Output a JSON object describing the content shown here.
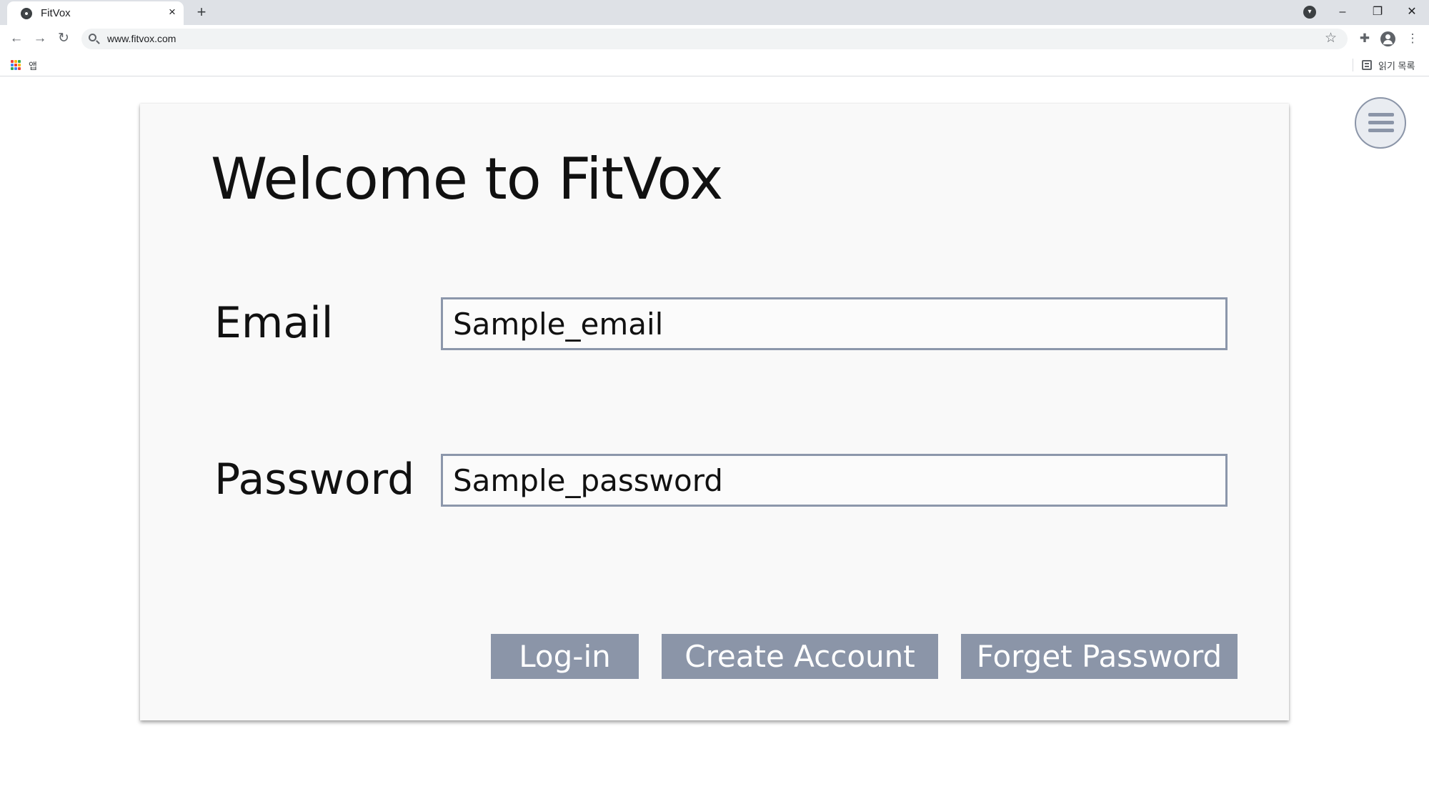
{
  "browser": {
    "tab_title": "FitVox",
    "tab_close": "×",
    "new_tab": "+",
    "url": "www.fitvox.com",
    "bookmarks": {
      "apps_label": "앱",
      "reading_list_label": "읽기 목록"
    },
    "icons": [
      "chrome-favicon-icon",
      "close-icon",
      "plus-icon",
      "tab-search-icon",
      "minimize-icon",
      "restore-icon",
      "close-window-icon",
      "back-icon",
      "forward-icon",
      "reload-icon",
      "search-icon",
      "star-icon",
      "extensions-icon",
      "profile-icon",
      "kebab-menu-icon",
      "apps-grid-icon",
      "reading-list-icon"
    ]
  },
  "page": {
    "title": "Welcome to FitVox",
    "email": {
      "label": "Email",
      "value": "Sample_email"
    },
    "password": {
      "label": "Password",
      "value": "Sample_password"
    },
    "buttons": {
      "login": "Log-in",
      "create_account": "Create Account",
      "forget_password": "Forget Password"
    },
    "menu_icon": "hamburger-menu-icon"
  },
  "colors": {
    "card_bg": "#f9f9f9",
    "button_bg": "#8b95a8",
    "input_border": "#8c97ab",
    "text": "#111111"
  }
}
